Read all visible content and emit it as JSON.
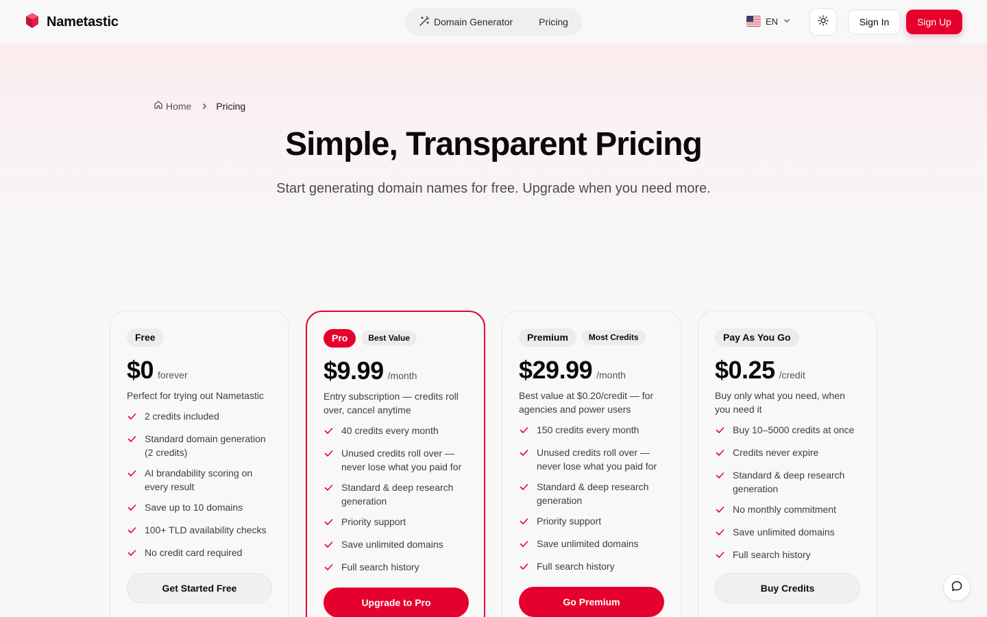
{
  "header": {
    "brand": "Nametastic",
    "nav": [
      {
        "label": "Domain Generator",
        "icon": "magic-wand-icon"
      },
      {
        "label": "Pricing"
      }
    ],
    "language": "EN",
    "sign_in": "Sign In",
    "sign_up": "Sign Up"
  },
  "breadcrumb": {
    "home": "Home",
    "current": "Pricing"
  },
  "hero": {
    "title": "Simple, Transparent Pricing",
    "subtitle": "Start generating domain names for free. Upgrade when you need more."
  },
  "colors": {
    "accent": "#e6002e",
    "brand_gem": "#e11d48"
  },
  "plans": [
    {
      "name": "Free",
      "price": "$0",
      "period": "forever",
      "description": "Perfect for trying out Nametastic",
      "features": [
        "2 credits included",
        "Standard domain generation (2 credits)",
        "AI brandability scoring on every result",
        "Save up to 10 domains",
        "100+ TLD availability checks",
        "No credit card required"
      ],
      "cta": "Get Started Free"
    },
    {
      "name": "Pro",
      "tag": "Best Value",
      "price": "$9.99",
      "period": "/month",
      "description": "Entry subscription — credits roll over, cancel anytime",
      "features": [
        "40 credits every month",
        "Unused credits roll over — never lose what you paid for",
        "Standard & deep research generation",
        "Priority support",
        "Save unlimited domains",
        "Full search history"
      ],
      "cta": "Upgrade to Pro"
    },
    {
      "name": "Premium",
      "tag": "Most Credits",
      "price": "$29.99",
      "period": "/month",
      "description": "Best value at $0.20/credit — for agencies and power users",
      "features": [
        "150 credits every month",
        "Unused credits roll over — never lose what you paid for",
        "Standard & deep research generation",
        "Priority support",
        "Save unlimited domains",
        "Full search history"
      ],
      "cta": "Go Premium"
    },
    {
      "name": "Pay As You Go",
      "price": "$0.25",
      "period": "/credit",
      "description": "Buy only what you need, when you need it",
      "features": [
        "Buy 10–5000 credits at once",
        "Credits never expire",
        "Standard & deep research generation",
        "No monthly commitment",
        "Save unlimited domains",
        "Full search history"
      ],
      "cta": "Buy Credits"
    }
  ]
}
